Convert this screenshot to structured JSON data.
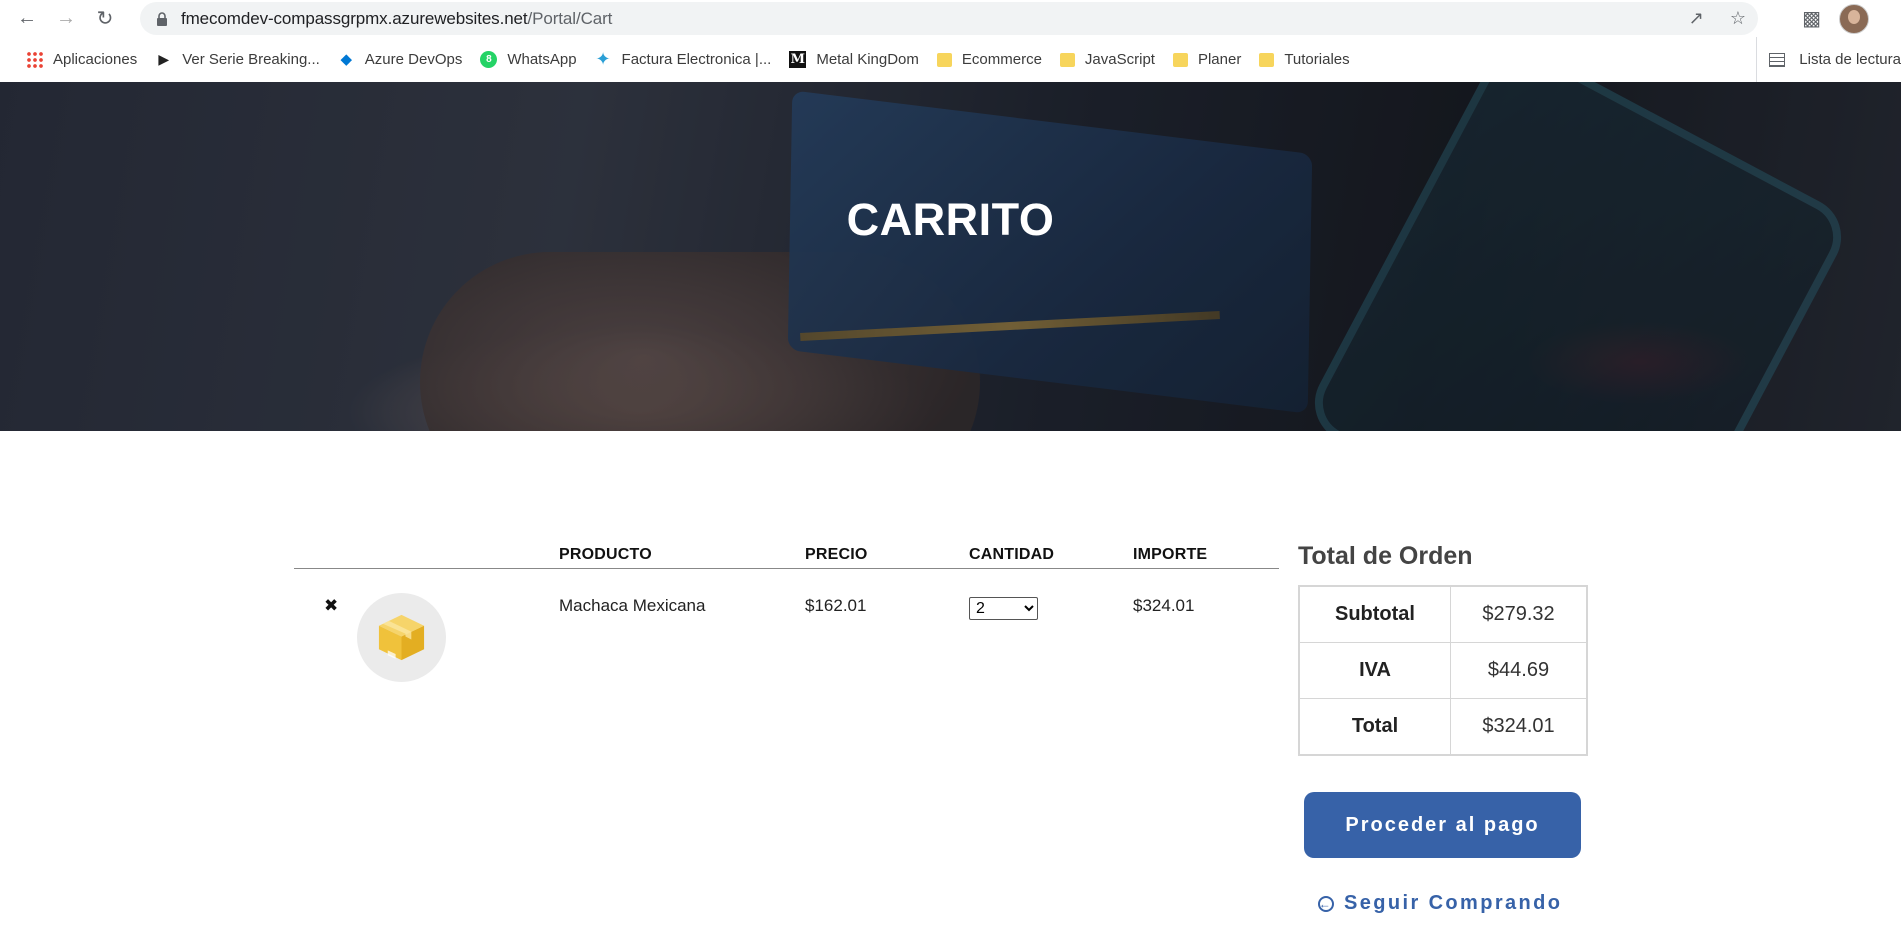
{
  "browser": {
    "url_host": "fmecomdev-compassgrpmx.azurewebsites.net",
    "url_path": "/Portal/Cart",
    "bookmarks": [
      {
        "label": "Aplicaciones",
        "icon": "apps-grid-icon"
      },
      {
        "label": "Ver Serie Breaking...",
        "icon": "play-icon"
      },
      {
        "label": "Azure DevOps",
        "icon": "azure-devops-icon"
      },
      {
        "label": "WhatsApp",
        "icon": "whatsapp-icon"
      },
      {
        "label": "Factura Electronica |...",
        "icon": "factura-icon"
      },
      {
        "label": "Metal KingDom",
        "icon": "metal-m-icon"
      },
      {
        "label": "Ecommerce",
        "icon": "folder-icon"
      },
      {
        "label": "JavaScript",
        "icon": "folder-icon"
      },
      {
        "label": "Planer",
        "icon": "folder-icon"
      },
      {
        "label": "Tutoriales",
        "icon": "folder-icon"
      }
    ],
    "reading_list": "Lista de lectura"
  },
  "hero": {
    "title": "CARRITO"
  },
  "cart": {
    "headers": {
      "product": "PRODUCTO",
      "price": "PRECIO",
      "quantity": "CANTIDAD",
      "amount": "IMPORTE"
    },
    "items": [
      {
        "remove": "✖",
        "name": "Machaca Mexicana",
        "price": "$162.01",
        "quantity": "2",
        "amount": "$324.01"
      }
    ]
  },
  "order": {
    "title": "Total de Orden",
    "rows": [
      {
        "label": "Subtotal",
        "value": "$279.32"
      },
      {
        "label": "IVA",
        "value": "$44.69"
      },
      {
        "label": "Total",
        "value": "$324.01"
      }
    ],
    "pay_label": "Proceder al pago",
    "continue_label": "Seguir Comprando"
  },
  "colors": {
    "accent": "#3762a8",
    "box": "#f2c94c"
  }
}
